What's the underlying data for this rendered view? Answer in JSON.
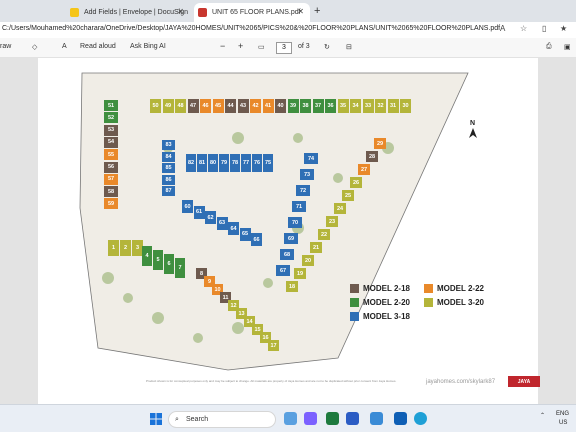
{
  "browser": {
    "tabs": [
      {
        "label": "Add Fields | Envelope | DocuSign",
        "active": false
      },
      {
        "label": "UNIT 65 FLOOR PLANS.pdf",
        "active": true
      }
    ],
    "new_tab_label": "+",
    "address": "C:/Users/Mouhamed%20charara/OneDrive/Desktop/JAYA%20HOMES/UNIT%2065/PICS%20&%20FLOOR%20PLANS/UNIT%2065%20FLOOR%20PLANS.pdf",
    "addr_icons": [
      "a-icon",
      "star-icon",
      "split-icon",
      "favorites-icon"
    ]
  },
  "pdf_toolbar": {
    "draw": "raw",
    "read_aloud": "Read aloud",
    "ask_bing": "Ask Bing AI",
    "zoom_minus": "−",
    "zoom_plus": "+",
    "page_current": "3",
    "page_total": "of 3"
  },
  "siteplan": {
    "north": "N",
    "legend": [
      {
        "label": "MODEL 2-18",
        "color": "#6e5a4e"
      },
      {
        "label": "MODEL 2-22",
        "color": "#e9892a"
      },
      {
        "label": "MODEL 2-20",
        "color": "#3f8f3f"
      },
      {
        "label": "MODEL 3-20",
        "color": "#b4b53a"
      },
      {
        "label": "MODEL 3-18",
        "color": "#2f6fb5"
      }
    ],
    "disclaimer": "Product shown is for conceptual purposes only and may be subject to change. All materials are property of Jaya Homes and are not to be duplicated without prior consent from Jaya Homes.",
    "url": "jayahomes.com/skylark87",
    "logo": "JAYA",
    "top_row": [
      "50",
      "49",
      "48",
      "47",
      "46",
      "45",
      "44",
      "43",
      "42",
      "41",
      "40",
      "39",
      "38",
      "37",
      "36",
      "35",
      "34",
      "33",
      "32",
      "31",
      "30"
    ],
    "left_col": [
      "51",
      "52",
      "53",
      "54",
      "55",
      "56",
      "57",
      "58",
      "59"
    ],
    "blue_col": [
      "83",
      "84",
      "85",
      "86",
      "87"
    ],
    "blue_row": [
      "82",
      "81",
      "80",
      "79",
      "78",
      "77",
      "76",
      "75"
    ],
    "blue_diag": [
      "74",
      "73",
      "72",
      "71",
      "70",
      "69",
      "68",
      "67"
    ],
    "blue_lower": [
      "60",
      "61",
      "62",
      "63",
      "64",
      "65",
      "66"
    ],
    "right_col": [
      "29",
      "28",
      "27",
      "26",
      "25",
      "24",
      "23",
      "22",
      "21",
      "20",
      "19",
      "18"
    ],
    "bottom_left": [
      "1",
      "2",
      "3"
    ],
    "green_bottom": [
      "4",
      "5",
      "6",
      "7"
    ],
    "bottom_mid": [
      "8",
      "9",
      "10",
      "11",
      "12",
      "13",
      "14",
      "15",
      "16",
      "17"
    ]
  },
  "taskbar": {
    "search_placeholder": "Search",
    "lang": "ENG",
    "region": "US"
  }
}
